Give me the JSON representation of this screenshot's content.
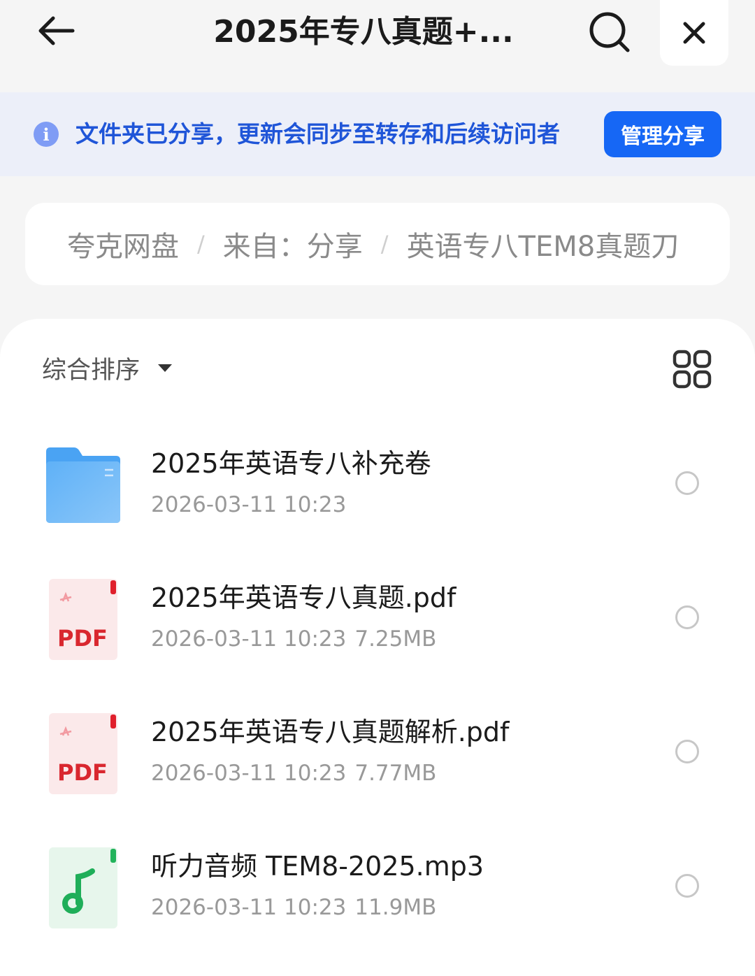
{
  "header": {
    "title": "2025年专八真题+...",
    "back_icon": "arrow-left-icon",
    "search_icon": "search-icon",
    "close_icon": "close-icon"
  },
  "notice": {
    "icon": "info-icon",
    "icon_glyph": "i",
    "text": "文件夹已分享，更新会同步至转存和后续访问者",
    "button_label": "管理分享",
    "accent_color": "#1667f5"
  },
  "breadcrumb": {
    "items": [
      "夸克网盘",
      "来自：分享",
      "英语专八TEM8真题刀"
    ],
    "separator": "/"
  },
  "toolbar": {
    "sort_label": "综合排序",
    "sort_icon": "caret-down-icon",
    "view_toggle_icon": "grid-view-icon"
  },
  "files": [
    {
      "type": "folder",
      "icon": "folder-icon",
      "name": "2025年英语专八补充卷",
      "date": "2026-03-11 10:23",
      "size": ""
    },
    {
      "type": "pdf",
      "icon": "pdf-file-icon",
      "badge": "PDF",
      "name": "2025年英语专八真题.pdf",
      "date": "2026-03-11 10:23",
      "size": "7.25MB"
    },
    {
      "type": "pdf",
      "icon": "pdf-file-icon",
      "badge": "PDF",
      "name": "2025年英语专八真题解析.pdf",
      "date": "2026-03-11 10:23",
      "size": "7.77MB"
    },
    {
      "type": "audio",
      "icon": "audio-file-icon",
      "name": "听力音频 TEM8-2025.mp3",
      "date": "2026-03-11 10:23",
      "size": "11.9MB"
    }
  ]
}
